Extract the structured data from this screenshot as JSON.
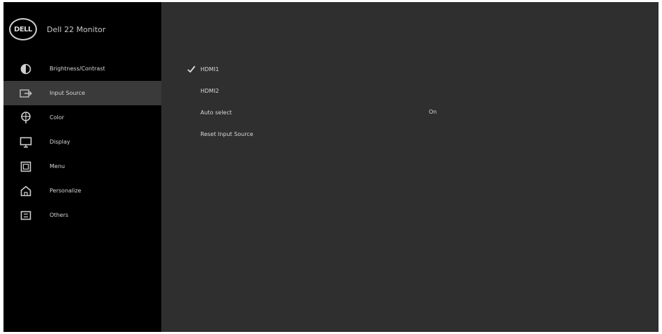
{
  "brand": {
    "logo_text": "DELL",
    "title": "Dell 22 Monitor"
  },
  "menu": {
    "items": [
      {
        "label": "Brightness/Contrast",
        "icon": "brightness-icon"
      },
      {
        "label": "Input Source",
        "icon": "input-source-icon"
      },
      {
        "label": "Color",
        "icon": "color-icon"
      },
      {
        "label": "Display",
        "icon": "display-icon"
      },
      {
        "label": "Menu",
        "icon": "menu-icon"
      },
      {
        "label": "Personalize",
        "icon": "personalize-icon"
      },
      {
        "label": "Others",
        "icon": "others-icon"
      }
    ],
    "active_index": 1
  },
  "input_source": {
    "options": [
      "HDMI1",
      "HDMI2",
      "Auto select",
      "Reset Input Source"
    ],
    "selected_index": 0,
    "auto_select_value": "On"
  },
  "colors": {
    "background": "#2f2f2f",
    "sidebar": "#000000",
    "active_item": "#3a3a3a",
    "text": "#d9d9d9"
  }
}
